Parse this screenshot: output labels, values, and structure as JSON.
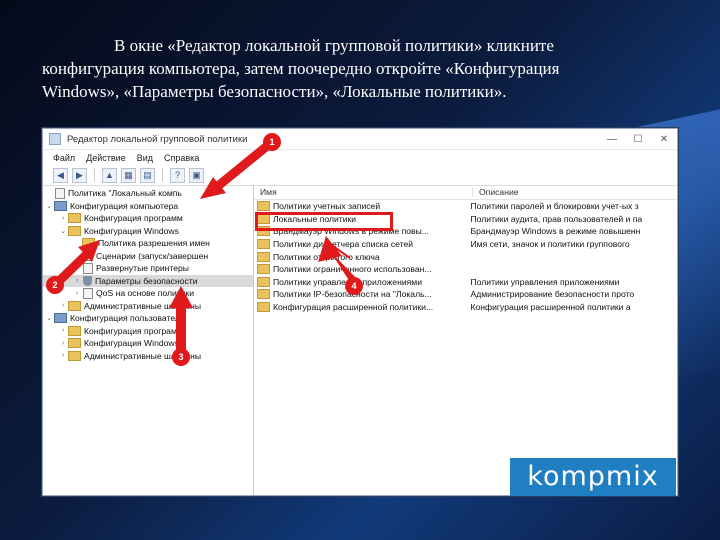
{
  "caption": {
    "line1": "В окне «Редактор локальной групповой политики» кликните",
    "line2": "конфигурация компьютера, затем поочередно откройте «Конфигурация",
    "line3": "Windows», «Параметры безопасности», «Локальные политики»."
  },
  "window": {
    "title": "Редактор локальной групповой политики",
    "buttons": [
      "—",
      "☐",
      "✕"
    ]
  },
  "menu": [
    "Файл",
    "Действие",
    "Вид",
    "Справка"
  ],
  "tree": [
    {
      "label": "Политика \"Локальный компь",
      "level": 0,
      "icon": "doc"
    },
    {
      "label": "Конфигурация компьютера",
      "level": 0,
      "icon": "pc",
      "arrow": "v"
    },
    {
      "label": "Конфигурация программ",
      "level": 1,
      "icon": "folder",
      "arrow": ">"
    },
    {
      "label": "Конфигурация Windows",
      "level": 1,
      "icon": "folder",
      "arrow": "v"
    },
    {
      "label": "Политика разрешения имен",
      "level": 2,
      "icon": "folder"
    },
    {
      "label": "Сценарии (запуск/завершен",
      "level": 2,
      "icon": "doc"
    },
    {
      "label": "Развернутые принтеры",
      "level": 2,
      "icon": "doc",
      "arrow": ">"
    },
    {
      "label": "Параметры безопасности",
      "level": 2,
      "icon": "shield",
      "arrow": ">",
      "selected": true
    },
    {
      "label": "QoS на основе политики",
      "level": 2,
      "icon": "doc",
      "arrow": ">"
    },
    {
      "label": "Административные шаблоны",
      "level": 1,
      "icon": "folder",
      "arrow": ">"
    },
    {
      "label": "Конфигурация пользователя",
      "level": 0,
      "icon": "pc",
      "arrow": "v"
    },
    {
      "label": "Конфигурация программ",
      "level": 1,
      "icon": "folder",
      "arrow": ">"
    },
    {
      "label": "Конфигурация Windows",
      "level": 1,
      "icon": "folder",
      "arrow": ">"
    },
    {
      "label": "Административные шаблоны",
      "level": 1,
      "icon": "folder",
      "arrow": ">"
    }
  ],
  "list": {
    "col_name": "Имя",
    "col_desc": "Описание",
    "rows": [
      {
        "name": "Политики учетных записей",
        "desc": "Политики паролей и блокировки учет-ых з"
      },
      {
        "name": "Локальные политики",
        "desc": "Политики аудита, прав пользователей и па"
      },
      {
        "name": "Брандмауэр Windows в режиме повы...",
        "desc": "Брандмауэр Windows в режиме повышенн"
      },
      {
        "name": "Политики диспетчера списка сетей",
        "desc": "Имя сети, значок и политики группового"
      },
      {
        "name": "Политики открытого ключа",
        "desc": ""
      },
      {
        "name": "Политики ограниченного использован...",
        "desc": ""
      },
      {
        "name": "Политики управления приложениями",
        "desc": "Политики управления приложениями"
      },
      {
        "name": "Политики IP-безопасности на \"Локаль...",
        "desc": "Администрирование безопасности прото"
      },
      {
        "name": "Конфигурация расширенной политики...",
        "desc": "Конфигурация расширенной политики а"
      }
    ]
  },
  "callouts": [
    "1",
    "2",
    "3",
    "4"
  ],
  "brand": "kompmix",
  "colors": {
    "arrow": "#e01a1a",
    "brand_bg": "#1f7fc2",
    "selection": "#d9d9d9"
  }
}
